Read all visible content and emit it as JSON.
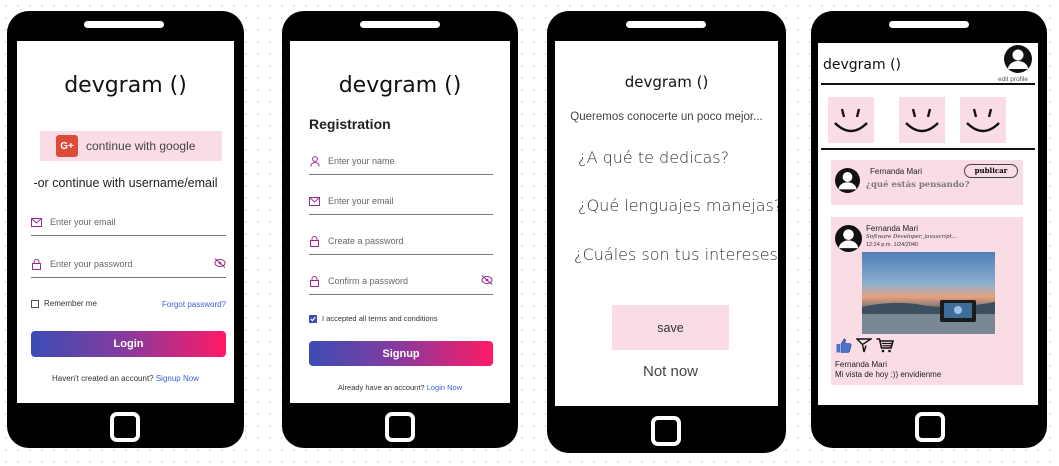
{
  "screen1": {
    "app_title": "devgram ()",
    "google_button": "continue with google",
    "google_badge": "G+",
    "alt_text": "-or continue with username/email",
    "email_placeholder": "Enter your email",
    "password_placeholder": "Enter your password",
    "remember_label": "Remember me",
    "forgot_link": "Forgot password?",
    "login_button": "Login",
    "footer_text": "Haven't created an account?",
    "footer_link": "Signup Now"
  },
  "screen2": {
    "app_title": "devgram ()",
    "heading": "Registration",
    "name_placeholder": "Enter your name",
    "email_placeholder": "Enter your email",
    "password_placeholder": "Create a password",
    "confirm_placeholder": "Confirm a password",
    "terms_label": "I accepted all terms and conditions",
    "terms_checked": true,
    "signup_button": "Signup",
    "footer_text": "Already have an account?",
    "footer_link": "Login Now"
  },
  "screen3": {
    "app_title": "devgram ()",
    "subtitle": "Queremos conocerte un poco mejor...",
    "question1": "¿A qué te dedicas?",
    "question2": "¿Qué lenguajes manejas?",
    "question3": "¿Cuáles son tus intereses?",
    "save_button": "save",
    "not_now": "Not now"
  },
  "screen4": {
    "app_title": "devgram ()",
    "edit_profile": "edit profile",
    "composer_name": "Fernanda Mari",
    "publish_button": "publicar",
    "composer_placeholder": "¿qué estás pensando?",
    "post_author": "Fernanda Mari",
    "post_role": "Software Developer, javascript...",
    "post_time": "12:24 p.m. 1/24/2040",
    "post_caption_name": "Fernanda Mari",
    "post_caption_text": "Mi vista de hoy :)) envidienme"
  },
  "colors": {
    "pink": "#fadde4",
    "accent_purple": "#9b2a8f",
    "gradient_start": "#3b4db5",
    "gradient_end": "#ff1a66",
    "link": "#3a62d6",
    "google_red": "#dd4b39"
  }
}
